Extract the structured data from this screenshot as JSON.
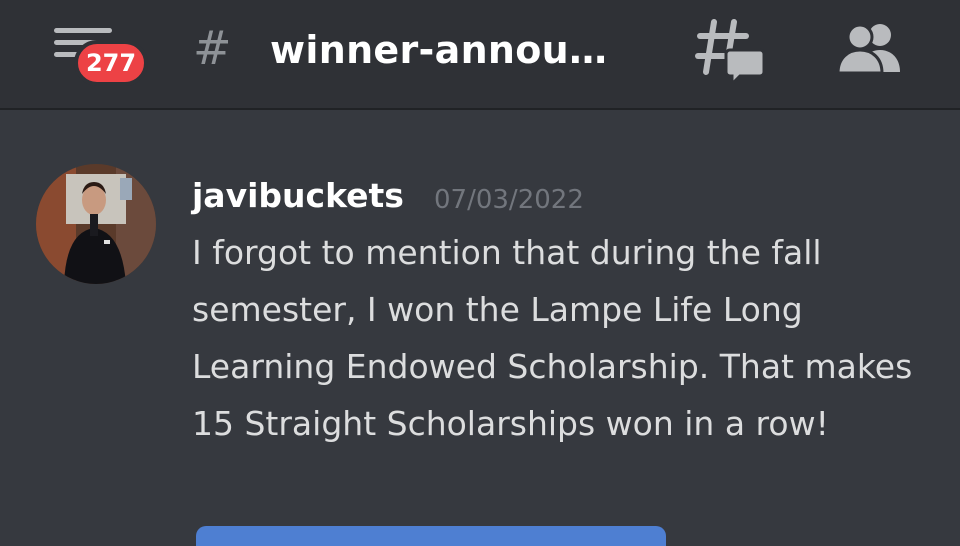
{
  "header": {
    "badge_count": "277",
    "hash_symbol": "#",
    "channel_name": "winner-annou…",
    "icons": {
      "menu": "hamburger-menu-icon",
      "threads": "threads-icon",
      "members": "members-icon"
    }
  },
  "message": {
    "username": "javibuckets",
    "timestamp": "07/03/2022",
    "content": "I forgot to mention that during the fall semester, I won the Lampe Life Long Learning Endowed Scholarship. That makes 15 Straight Scholarships won in a row!"
  },
  "colors": {
    "background": "#36393f",
    "header": "#2f3136",
    "badge": "#ed4245",
    "text": "#dcddde",
    "muted": "#72767d",
    "accent": "#4e7fd2"
  }
}
